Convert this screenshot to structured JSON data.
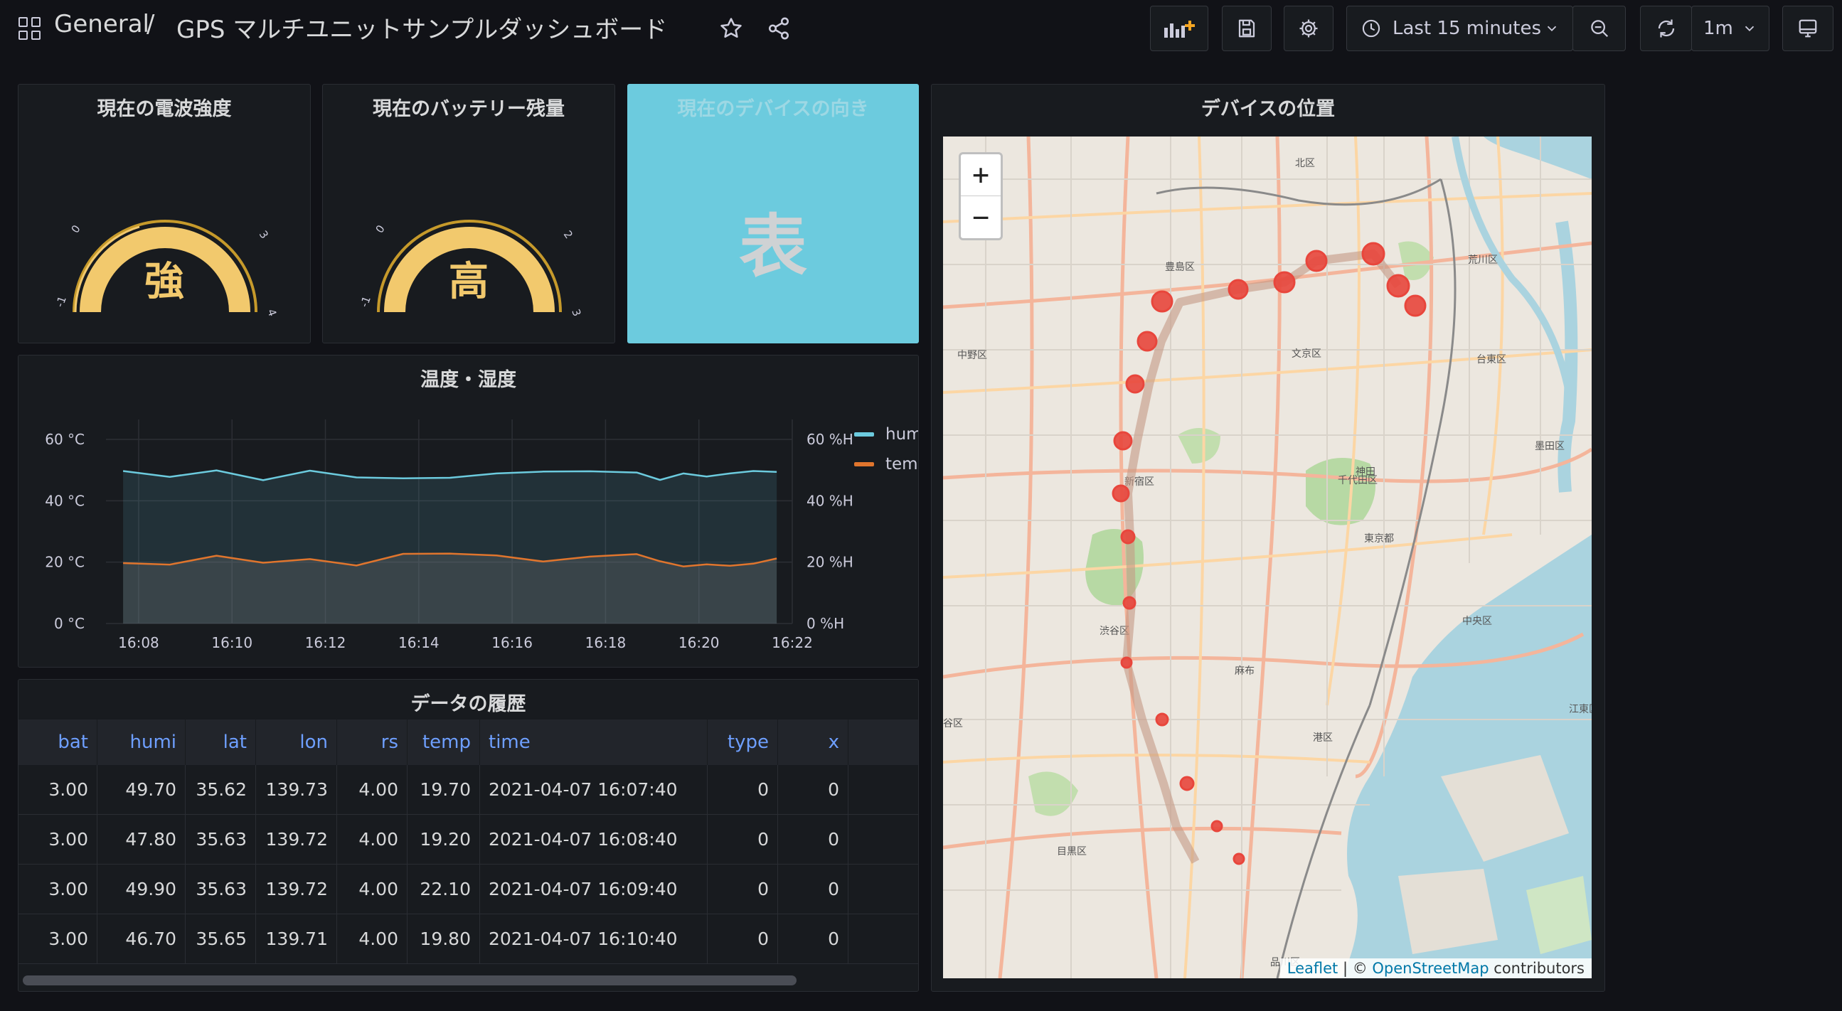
{
  "header": {
    "breadcrumb_root": "General",
    "breadcrumb_sep": "/",
    "dashboard_title": "GPS マルチユニットサンプルダッシュボード",
    "time_range": "Last 15 minutes",
    "refresh_interval": "1m"
  },
  "panels": {
    "signal": {
      "title": "現在の電波強度",
      "value": "強",
      "ticks": [
        "-1",
        "0",
        "3",
        "4"
      ]
    },
    "battery": {
      "title": "現在のバッテリー残量",
      "value": "高",
      "ticks": [
        "-1",
        "0",
        "2",
        "3"
      ]
    },
    "orientation": {
      "title": "現在のデバイスの向き",
      "value": "表"
    },
    "chart": {
      "title": "温度・湿度"
    },
    "table": {
      "title": "データの履歴"
    },
    "map": {
      "title": "デバイスの位置"
    }
  },
  "chart_data": {
    "type": "area",
    "x": [
      "16:07:40",
      "16:08:40",
      "16:09:40",
      "16:10:40",
      "16:11:40",
      "16:12:40",
      "16:13:40",
      "16:14:40",
      "16:15:40",
      "16:16:40",
      "16:17:40",
      "16:18:40",
      "16:19:10",
      "16:19:40",
      "16:20:10",
      "16:20:40",
      "16:21:10",
      "16:21:40"
    ],
    "xticks": [
      "16:08",
      "16:10",
      "16:12",
      "16:14",
      "16:16",
      "16:18",
      "16:20",
      "16:22"
    ],
    "yticks_left": [
      "0 °C",
      "20 °C",
      "40 °C",
      "60 °C"
    ],
    "yticks_right": [
      "0 %H",
      "20 %H",
      "40 %H",
      "60 %H"
    ],
    "ylim": [
      0,
      60
    ],
    "series": [
      {
        "name": "humi",
        "color": "#6ccbde",
        "values": [
          49.7,
          47.8,
          49.9,
          46.7,
          49.8,
          47.6,
          47.3,
          47.5,
          48.9,
          49.5,
          49.6,
          49.2,
          46.8,
          48.9,
          47.9,
          48.9,
          49.7,
          49.4
        ]
      },
      {
        "name": "temp",
        "color": "#e0752d",
        "values": [
          19.7,
          19.2,
          22.1,
          19.8,
          21.0,
          18.9,
          22.7,
          22.8,
          22.2,
          20.2,
          21.8,
          22.6,
          20.3,
          18.6,
          19.3,
          18.8,
          19.5,
          21.2
        ]
      }
    ],
    "grid": true,
    "legend": "right"
  },
  "table": {
    "columns": [
      "bat",
      "humi",
      "lat",
      "lon",
      "rs",
      "temp",
      "time",
      "type",
      "x"
    ],
    "rows": [
      [
        "3.00",
        "49.70",
        "35.62",
        "139.73",
        "4.00",
        "19.70",
        "2021-04-07 16:07:40",
        "0",
        "0"
      ],
      [
        "3.00",
        "47.80",
        "35.63",
        "139.72",
        "4.00",
        "19.20",
        "2021-04-07 16:08:40",
        "0",
        "0"
      ],
      [
        "3.00",
        "49.90",
        "35.63",
        "139.72",
        "4.00",
        "22.10",
        "2021-04-07 16:09:40",
        "0",
        "0"
      ],
      [
        "3.00",
        "46.70",
        "35.65",
        "139.71",
        "4.00",
        "19.80",
        "2021-04-07 16:10:40",
        "0",
        "0"
      ]
    ]
  },
  "map": {
    "zoom_in": "+",
    "zoom_out": "−",
    "attribution_leaflet": "Leaflet",
    "attribution_sep": " | © ",
    "attribution_osm": "OpenStreetMap",
    "attribution_suffix": " contributors",
    "labels": [
      "北区",
      "豊島区",
      "荒川区",
      "中野区",
      "文京区",
      "台東区",
      "墨田区",
      "千代田区",
      "新宿区",
      "東京都",
      "中央区",
      "渋谷区",
      "港区",
      "江東区",
      "目黒区",
      "品川区",
      "神田",
      "麻布",
      "谷区"
    ]
  },
  "colors": {
    "accent": "#6e9fff",
    "gauge": "#f2c96d",
    "marker": "#e8463c"
  }
}
